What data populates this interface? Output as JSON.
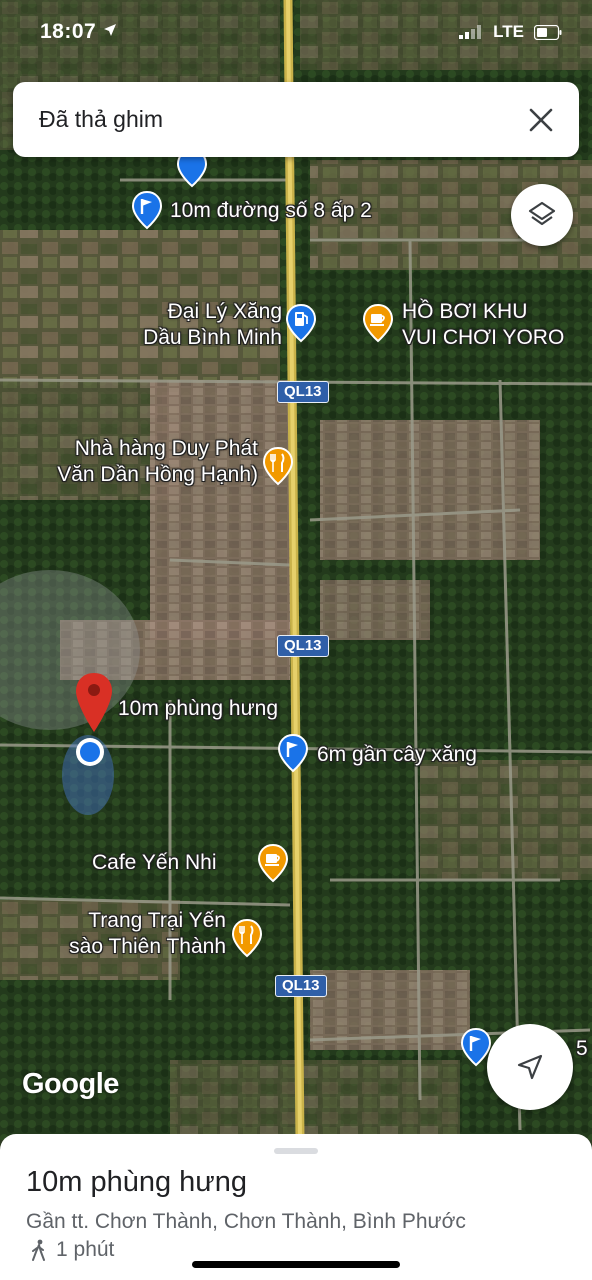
{
  "status_bar": {
    "time": "18:07",
    "network": "LTE"
  },
  "banner": {
    "text": "Đã thả ghim",
    "close_icon": "close-icon"
  },
  "map": {
    "places": [
      {
        "id": "so8",
        "text": "10m đường số 8 ấp 2",
        "icon": "flag-pin-icon"
      },
      {
        "id": "xang",
        "line1": "Đại Lý Xăng",
        "line2": "Dầu Bình Minh",
        "icon": "gas-station-pin-icon"
      },
      {
        "id": "hoboi",
        "line1": "HỒ BƠI KHU",
        "line2": "VUI CHƠI YORO",
        "icon": "cafe-pin-icon"
      },
      {
        "id": "duyphat",
        "line1": "Nhà hàng Duy Phát",
        "line2": "Văn Dần Hồng Hạnh)",
        "icon": "restaurant-pin-icon"
      },
      {
        "id": "phunghung",
        "text": "10m phùng hưng",
        "icon": "dropped-pin-icon"
      },
      {
        "id": "cayxang",
        "text": "6m gần cây xăng",
        "icon": "flag-pin-icon"
      },
      {
        "id": "yennhi",
        "text": "Cafe Yến Nhi",
        "icon": "cafe-pin-icon"
      },
      {
        "id": "trangtrai",
        "line1": "Trang Trại Yến",
        "line2": "sào Thiên Thành",
        "icon": "restaurant-pin-icon"
      }
    ],
    "road_shields": [
      "QL13",
      "QL13",
      "QL13"
    ],
    "partial_label": "5",
    "google_logo": "Google"
  },
  "controls": {
    "layers_icon": "layers-icon",
    "locate_icon": "navigation-arrow-icon"
  },
  "sheet": {
    "title": "10m phùng hưng",
    "address": "Gần tt. Chơn Thành, Chơn Thành, Bình Phước",
    "walk_time": "1 phút",
    "walk_icon": "walking-person-icon"
  },
  "colors": {
    "pin_red": "#d93025",
    "pin_blue": "#1a73e8",
    "pin_orange": "#f29900",
    "shield_blue": "#2f5fa8"
  }
}
